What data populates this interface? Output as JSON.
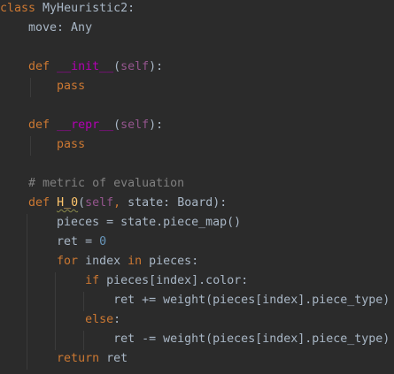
{
  "colors": {
    "background": "#2b2b2b",
    "text": "#a9b7c6",
    "keyword": "#cc7832",
    "self": "#94558d",
    "dunder": "#b200b2",
    "comment": "#808080",
    "number": "#6897bb",
    "function": "#ffc66d"
  },
  "code": [
    [
      {
        "t": "kw",
        "v": "class "
      },
      {
        "t": "",
        "v": "MyHeuristic2:"
      }
    ],
    [
      {
        "t": "",
        "v": "    move: Any"
      }
    ],
    [],
    [
      {
        "t": "",
        "v": "    "
      },
      {
        "t": "kw",
        "v": "def "
      },
      {
        "t": "dunder",
        "v": "__init__"
      },
      {
        "t": "",
        "v": "("
      },
      {
        "t": "self",
        "v": "self"
      },
      {
        "t": "",
        "v": "):"
      }
    ],
    [
      {
        "t": "",
        "v": "        "
      },
      {
        "t": "kw",
        "v": "pass"
      }
    ],
    [],
    [
      {
        "t": "",
        "v": "    "
      },
      {
        "t": "kw",
        "v": "def "
      },
      {
        "t": "dunder",
        "v": "__repr__"
      },
      {
        "t": "",
        "v": "("
      },
      {
        "t": "self",
        "v": "self"
      },
      {
        "t": "",
        "v": "):"
      }
    ],
    [
      {
        "t": "",
        "v": "        "
      },
      {
        "t": "kw",
        "v": "pass"
      }
    ],
    [],
    [
      {
        "t": "comment",
        "v": "    # metric of evaluation"
      }
    ],
    [
      {
        "t": "",
        "v": "    "
      },
      {
        "t": "kw",
        "v": "def "
      },
      {
        "t": "fn",
        "v": "H_0"
      },
      {
        "t": "",
        "v": "("
      },
      {
        "t": "self",
        "v": "self"
      },
      {
        "t": "kw",
        "v": ", "
      },
      {
        "t": "",
        "v": "state: Board):"
      }
    ],
    [
      {
        "t": "",
        "v": "        pieces = state.piece_map()"
      }
    ],
    [
      {
        "t": "",
        "v": "        ret = "
      },
      {
        "t": "num",
        "v": "0"
      }
    ],
    [
      {
        "t": "",
        "v": "        "
      },
      {
        "t": "kw",
        "v": "for "
      },
      {
        "t": "",
        "v": "index "
      },
      {
        "t": "kw",
        "v": "in "
      },
      {
        "t": "",
        "v": "pieces:"
      }
    ],
    [
      {
        "t": "",
        "v": "            "
      },
      {
        "t": "kw",
        "v": "if "
      },
      {
        "t": "",
        "v": "pieces[index].color:"
      }
    ],
    [
      {
        "t": "",
        "v": "                ret += weight(pieces[index].piece_type)"
      }
    ],
    [
      {
        "t": "",
        "v": "            "
      },
      {
        "t": "kw",
        "v": "else"
      },
      {
        "t": "",
        "v": ":"
      }
    ],
    [
      {
        "t": "",
        "v": "                ret -= weight(pieces[index].piece_type)"
      }
    ],
    [
      {
        "t": "",
        "v": "        "
      },
      {
        "t": "kw",
        "v": "return "
      },
      {
        "t": "",
        "v": "ret"
      }
    ]
  ]
}
